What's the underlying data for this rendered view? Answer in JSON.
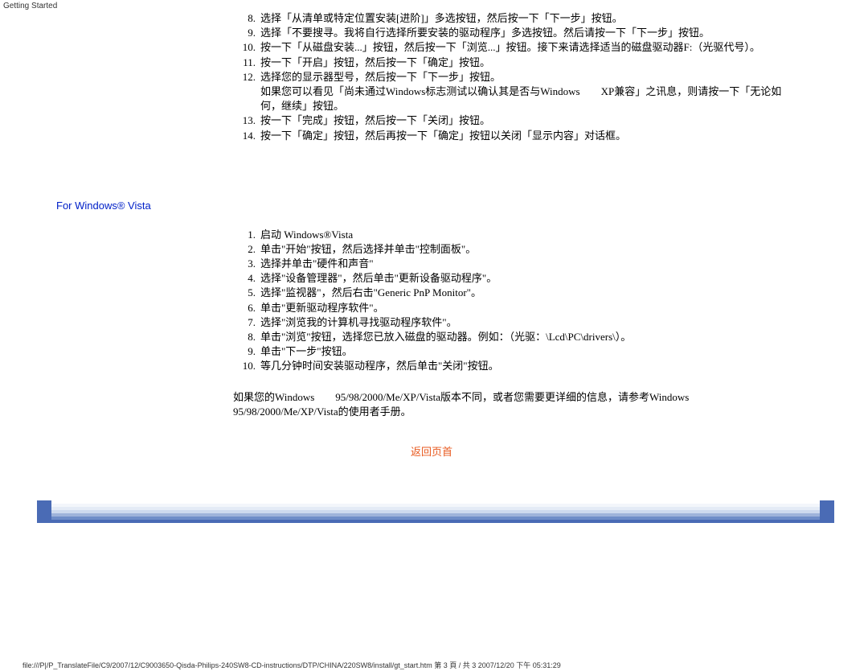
{
  "header": {
    "title": "Getting Started"
  },
  "xp_steps": [
    {
      "n": "8.",
      "t": "选择「从清单或特定位置安装[进阶]」多选按钮，然后按一下「下一步」按钮。"
    },
    {
      "n": "9.",
      "t": "选择「不要搜寻。我将自行选择所要安装的驱动程序」多选按钮。然后请按一下「下一步」按钮。"
    },
    {
      "n": "10.",
      "t": "按一下「从磁盘安装...」按钮，然后按一下「浏览...」按钮。接下来请选择适当的磁盘驱动器F:（光驱代号）。"
    },
    {
      "n": "11.",
      "t": "按一下「开启」按钮，然后按一下「确定」按钮。"
    },
    {
      "n": "12.",
      "t": "选择您的显示器型号，然后按一下「下一步」按钮。\n如果您可以看见「尚未通过Windows标志测试以确认其是否与Windows　　XP兼容」之讯息，则请按一下「无论如何，继续」按钮。"
    },
    {
      "n": "13.",
      "t": "按一下「完成」按钮，然后按一下「关闭」按钮。"
    },
    {
      "n": "14.",
      "t": "按一下「确定」按钮，然后再按一下「确定」按钮以关闭「显示内容」对话框。"
    }
  ],
  "vista_heading": "For Windows® Vista",
  "vista_steps": [
    {
      "n": "1.",
      "t": "启动 Windows®Vista"
    },
    {
      "n": "2.",
      "t": "单击\"开始\"按钮，然后选择并单击\"控制面板\"。"
    },
    {
      "n": "3.",
      "t": "选择并单击\"硬件和声音\""
    },
    {
      "n": "4.",
      "t": "选择\"设备管理器\"，然后单击\"更新设备驱动程序\"。"
    },
    {
      "n": "5.",
      "t": "选择\"监视器\"，然后右击\"Generic PnP Monitor\"。"
    },
    {
      "n": "6.",
      "t": "单击\"更新驱动程序软件\"。"
    },
    {
      "n": "7.",
      "t": "选择\"浏览我的计算机寻找驱动程序软件\"。"
    },
    {
      "n": "8.",
      "t": "单击\"浏览\"按钮，选择您已放入磁盘的驱动器。例如：（光驱：\\Lcd\\PC\\drivers\\）。"
    },
    {
      "n": "9.",
      "t": "单击\"下一步\"按钮。"
    },
    {
      "n": "10.",
      "t": "等几分钟时间安装驱动程序，然后单击\"关闭\"按钮。"
    }
  ],
  "note": "如果您的Windows　　95/98/2000/Me/XP/Vista版本不同，或者您需要更详细的信息，请参考Windows　　95/98/2000/Me/XP/Vista的使用者手册。",
  "back_to_top": "返回页首",
  "footer_path": "file:///P|/P_TranslateFile/C9/2007/12/C9003650-Qisda-Philips-240SW8-CD-instructions/DTP/CHINA/220SW8/install/gt_start.htm 第 3 頁 / 共 3 2007/12/20 下午 05:31:29"
}
